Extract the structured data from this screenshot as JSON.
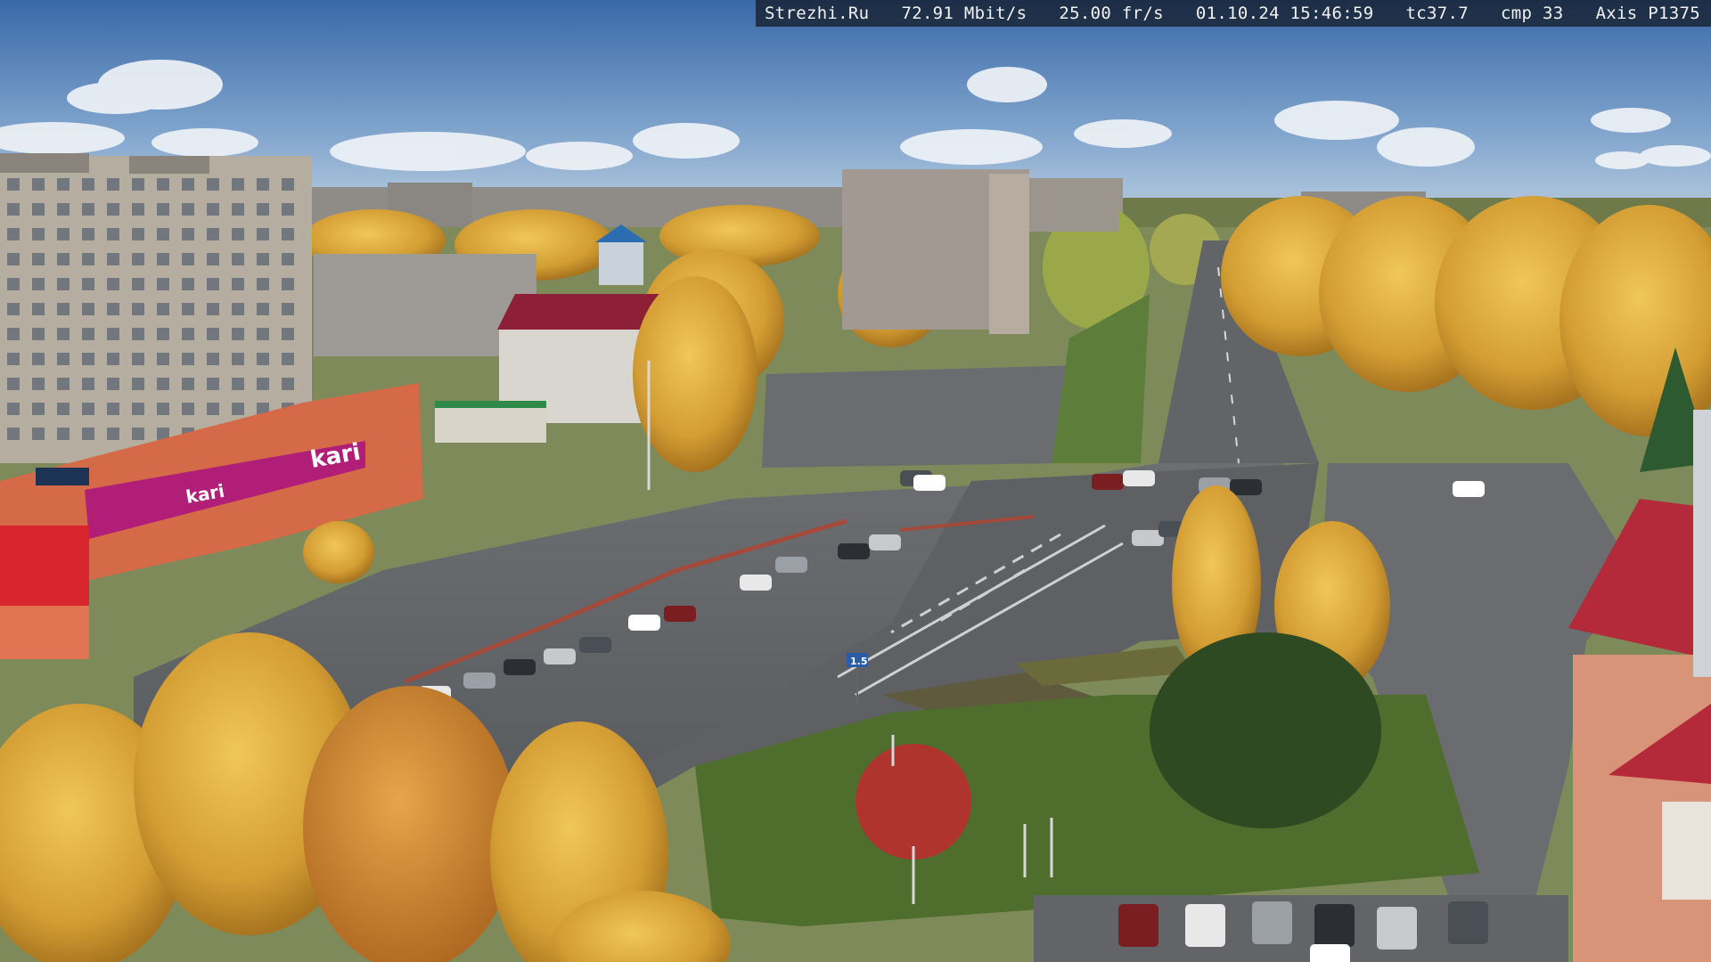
{
  "overlay": {
    "site": "Strezhi.Ru",
    "bitrate": "72.91 Mbit/s",
    "fps": "25.00 fr/s",
    "datetime": "01.10.24 15:46:59",
    "temperature": "tc37.7",
    "compression": "cmp 33",
    "camera_model": "Axis P1375"
  },
  "signs": {
    "store_logo": "kari",
    "store_logo_2": "kari",
    "street_sign": "1.5"
  },
  "colors": {
    "sky_top": "#3f6fae",
    "sky_horizon": "#a9c3dc",
    "foliage_gold": "#d6a437",
    "foliage_orange": "#c9852a",
    "asphalt": "#5d5f62",
    "grass": "#5d7d3a",
    "store_magenta": "#b01e78",
    "store_facade": "#d46a48",
    "roof_red": "#a8233c"
  }
}
